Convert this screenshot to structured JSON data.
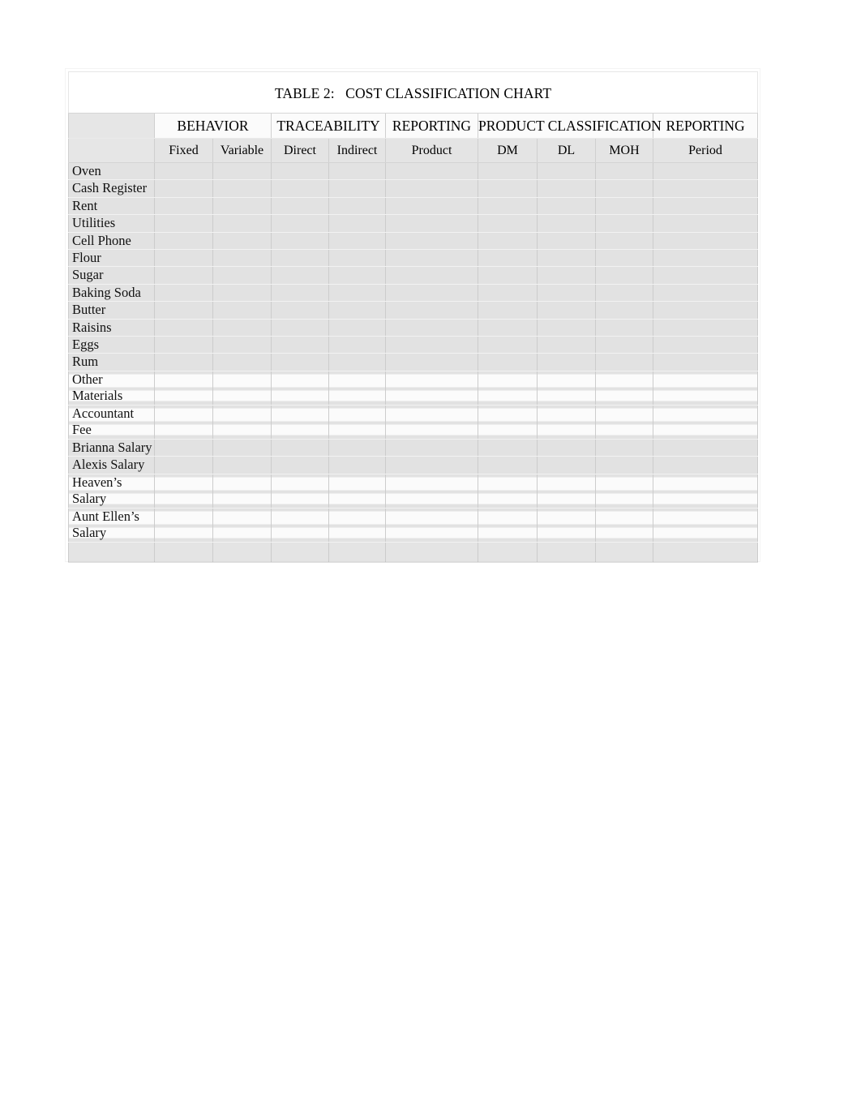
{
  "document": {
    "title_prefix": "TABLE 2:",
    "title_main": "COST CLASSIFICATION CHART",
    "title_full": "TABLE 2:   COST CLASSIFICATION CHART"
  },
  "table": {
    "corner_label": "",
    "group_headers": [
      {
        "label": "BEHAVIOR",
        "span": 2
      },
      {
        "label": "TRACEABILITY",
        "span": 2
      },
      {
        "label": "REPORTING",
        "span": 1
      },
      {
        "label": "PRODUCT CLASSIFICATION",
        "span": 3
      },
      {
        "label": "REPORTING",
        "span": 1
      }
    ],
    "sub_headers": [
      "Fixed",
      "Variable",
      "Direct",
      "Indirect",
      "Product",
      "DM",
      "DL",
      "MOH",
      "Period"
    ],
    "rows": [
      {
        "label": "Oven",
        "lines": [
          "Oven"
        ],
        "two_line": false,
        "values": [
          "",
          "",
          "",
          "",
          "",
          "",
          "",
          "",
          ""
        ]
      },
      {
        "label": "Cash Register",
        "lines": [
          "Cash Register"
        ],
        "two_line": false,
        "values": [
          "",
          "",
          "",
          "",
          "",
          "",
          "",
          "",
          ""
        ]
      },
      {
        "label": "Rent",
        "lines": [
          "Rent"
        ],
        "two_line": false,
        "values": [
          "",
          "",
          "",
          "",
          "",
          "",
          "",
          "",
          ""
        ]
      },
      {
        "label": "Utilities",
        "lines": [
          "Utilities"
        ],
        "two_line": false,
        "values": [
          "",
          "",
          "",
          "",
          "",
          "",
          "",
          "",
          ""
        ]
      },
      {
        "label": "Cell Phone",
        "lines": [
          "Cell Phone"
        ],
        "two_line": false,
        "values": [
          "",
          "",
          "",
          "",
          "",
          "",
          "",
          "",
          ""
        ]
      },
      {
        "label": "Flour",
        "lines": [
          "Flour"
        ],
        "two_line": false,
        "values": [
          "",
          "",
          "",
          "",
          "",
          "",
          "",
          "",
          ""
        ]
      },
      {
        "label": "Sugar",
        "lines": [
          "Sugar"
        ],
        "two_line": false,
        "values": [
          "",
          "",
          "",
          "",
          "",
          "",
          "",
          "",
          ""
        ]
      },
      {
        "label": "Baking Soda",
        "lines": [
          "Baking Soda"
        ],
        "two_line": false,
        "values": [
          "",
          "",
          "",
          "",
          "",
          "",
          "",
          "",
          ""
        ]
      },
      {
        "label": "Butter",
        "lines": [
          "Butter"
        ],
        "two_line": false,
        "values": [
          "",
          "",
          "",
          "",
          "",
          "",
          "",
          "",
          ""
        ]
      },
      {
        "label": "Raisins",
        "lines": [
          "Raisins"
        ],
        "two_line": false,
        "values": [
          "",
          "",
          "",
          "",
          "",
          "",
          "",
          "",
          ""
        ]
      },
      {
        "label": "Eggs",
        "lines": [
          "Eggs"
        ],
        "two_line": false,
        "values": [
          "",
          "",
          "",
          "",
          "",
          "",
          "",
          "",
          ""
        ]
      },
      {
        "label": "Rum",
        "lines": [
          "Rum"
        ],
        "two_line": false,
        "values": [
          "",
          "",
          "",
          "",
          "",
          "",
          "",
          "",
          ""
        ]
      },
      {
        "label": "Other Materials",
        "lines": [
          "Other",
          "Materials"
        ],
        "two_line": true,
        "values": [
          "",
          "",
          "",
          "",
          "",
          "",
          "",
          "",
          ""
        ]
      },
      {
        "label": "Accountant Fee",
        "lines": [
          "Accountant",
          "Fee"
        ],
        "two_line": true,
        "values": [
          "",
          "",
          "",
          "",
          "",
          "",
          "",
          "",
          ""
        ]
      },
      {
        "label": "Brianna Salary",
        "lines": [
          "Brianna Salary"
        ],
        "two_line": false,
        "values": [
          "",
          "",
          "",
          "",
          "",
          "",
          "",
          "",
          ""
        ]
      },
      {
        "label": "Alexis Salary",
        "lines": [
          "Alexis Salary"
        ],
        "two_line": false,
        "values": [
          "",
          "",
          "",
          "",
          "",
          "",
          "",
          "",
          ""
        ]
      },
      {
        "label": "Heaven’s Salary",
        "lines": [
          "Heaven’s",
          "Salary"
        ],
        "two_line": true,
        "values": [
          "",
          "",
          "",
          "",
          "",
          "",
          "",
          "",
          ""
        ]
      },
      {
        "label": "Aunt Ellen’s Salary",
        "lines": [
          "Aunt Ellen’s",
          "Salary"
        ],
        "two_line": true,
        "values": [
          "",
          "",
          "",
          "",
          "",
          "",
          "",
          "",
          ""
        ]
      }
    ],
    "trailing_blank_row": true
  },
  "colors": {
    "page_background": "#ffffff",
    "cell_fill": "#e2e2e2",
    "header_fill": "#fbfbfb",
    "subheader_fill": "#e4e4e4",
    "grid_line": "#cccccc",
    "text": "#000000"
  }
}
